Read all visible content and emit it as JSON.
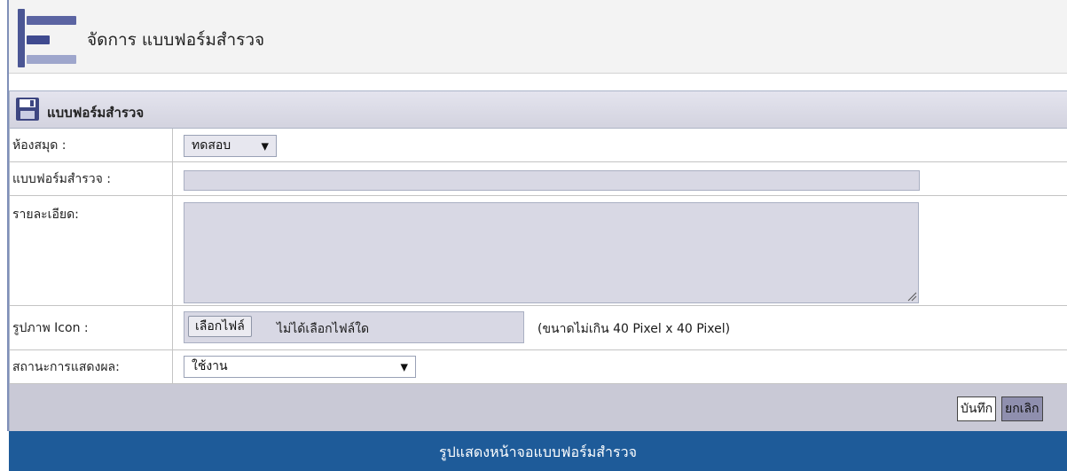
{
  "header": {
    "title": "จัดการ แบบฟอร์มสำรวจ"
  },
  "form": {
    "panel_title": "แบบฟอร์มสำรวจ",
    "fields": {
      "library": {
        "label": "ห้องสมุด :",
        "value": "ทดสอบ"
      },
      "survey_form": {
        "label": "แบบฟอร์มสำรวจ :",
        "value": ""
      },
      "details": {
        "label": "รายละเอียด:",
        "value": ""
      },
      "icon": {
        "label": "รูปภาพ Icon :",
        "button_label": "เลือกไฟล์",
        "status": "ไม่ได้เลือกไฟล์ใด",
        "hint": "(ขนาดไม่เกิน 40 Pixel x 40 Pixel)"
      },
      "display_status": {
        "label": "สถานะการแสดงผล:",
        "value": "ใช้งาน"
      }
    },
    "buttons": {
      "save": "บันทึก",
      "cancel": "ยกเลิก"
    }
  },
  "caption": "รูปแสดงหน้าจอแบบฟอร์มสำรวจ",
  "icons": {
    "logo": "menu-bars-icon",
    "panel": "floppy-disk-icon",
    "dropdown": "dropdown-arrow-icon",
    "resize": "resize-grip-icon"
  },
  "colors": {
    "caption_bar": "#1e5b99",
    "panel_header": "#d9d9e4",
    "logo_bar": "#3f4a8f"
  }
}
